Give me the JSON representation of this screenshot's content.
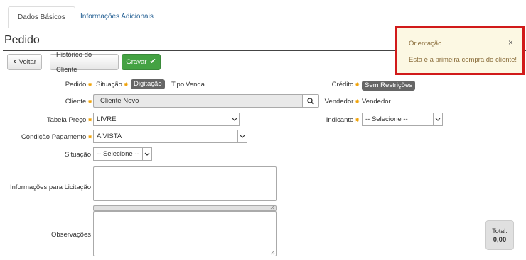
{
  "tabs": {
    "basic": "Dados Básicos",
    "additional": "Informações Adicionais"
  },
  "page_title": "Pedido",
  "toolbar": {
    "back_label": "Voltar",
    "history_label": "Histórico do Cliente",
    "save_label": "Gravar"
  },
  "form": {
    "pedido_label": "Pedido",
    "situacao_label": "Situação",
    "situacao_value": "Digitação",
    "tipo_label": "Tipo",
    "tipo_value": "Venda",
    "credito_label": "Crédito",
    "credito_value": "Sem Restrições",
    "cliente_label": "Cliente",
    "cliente_value": "Cliente Novo",
    "vendedor_label": "Vendedor",
    "vendedor_value": "Vendedor",
    "tabela_label": "Tabela Preço",
    "tabela_value": "LIVRE",
    "indicante_label": "Indicante",
    "indicante_value": "-- Selecione --",
    "condicao_label": "Condição Pagamento",
    "condicao_value": "A VISTA",
    "situacao2_label": "Situação",
    "situacao2_value": "-- Selecione --",
    "licitacao_label": "Informações para Licitação",
    "observacoes_label": "Observações"
  },
  "toast": {
    "title": "Orientação",
    "close": "×",
    "message": "Esta é a primeira compra do cliente!"
  },
  "total": {
    "label": "Total:",
    "value": "0,00"
  },
  "colors": {
    "save_green": "#44a243",
    "toast_border": "#d11a1a",
    "toast_bg": "#fcf8e3",
    "required_marker": "#f0a30a"
  }
}
